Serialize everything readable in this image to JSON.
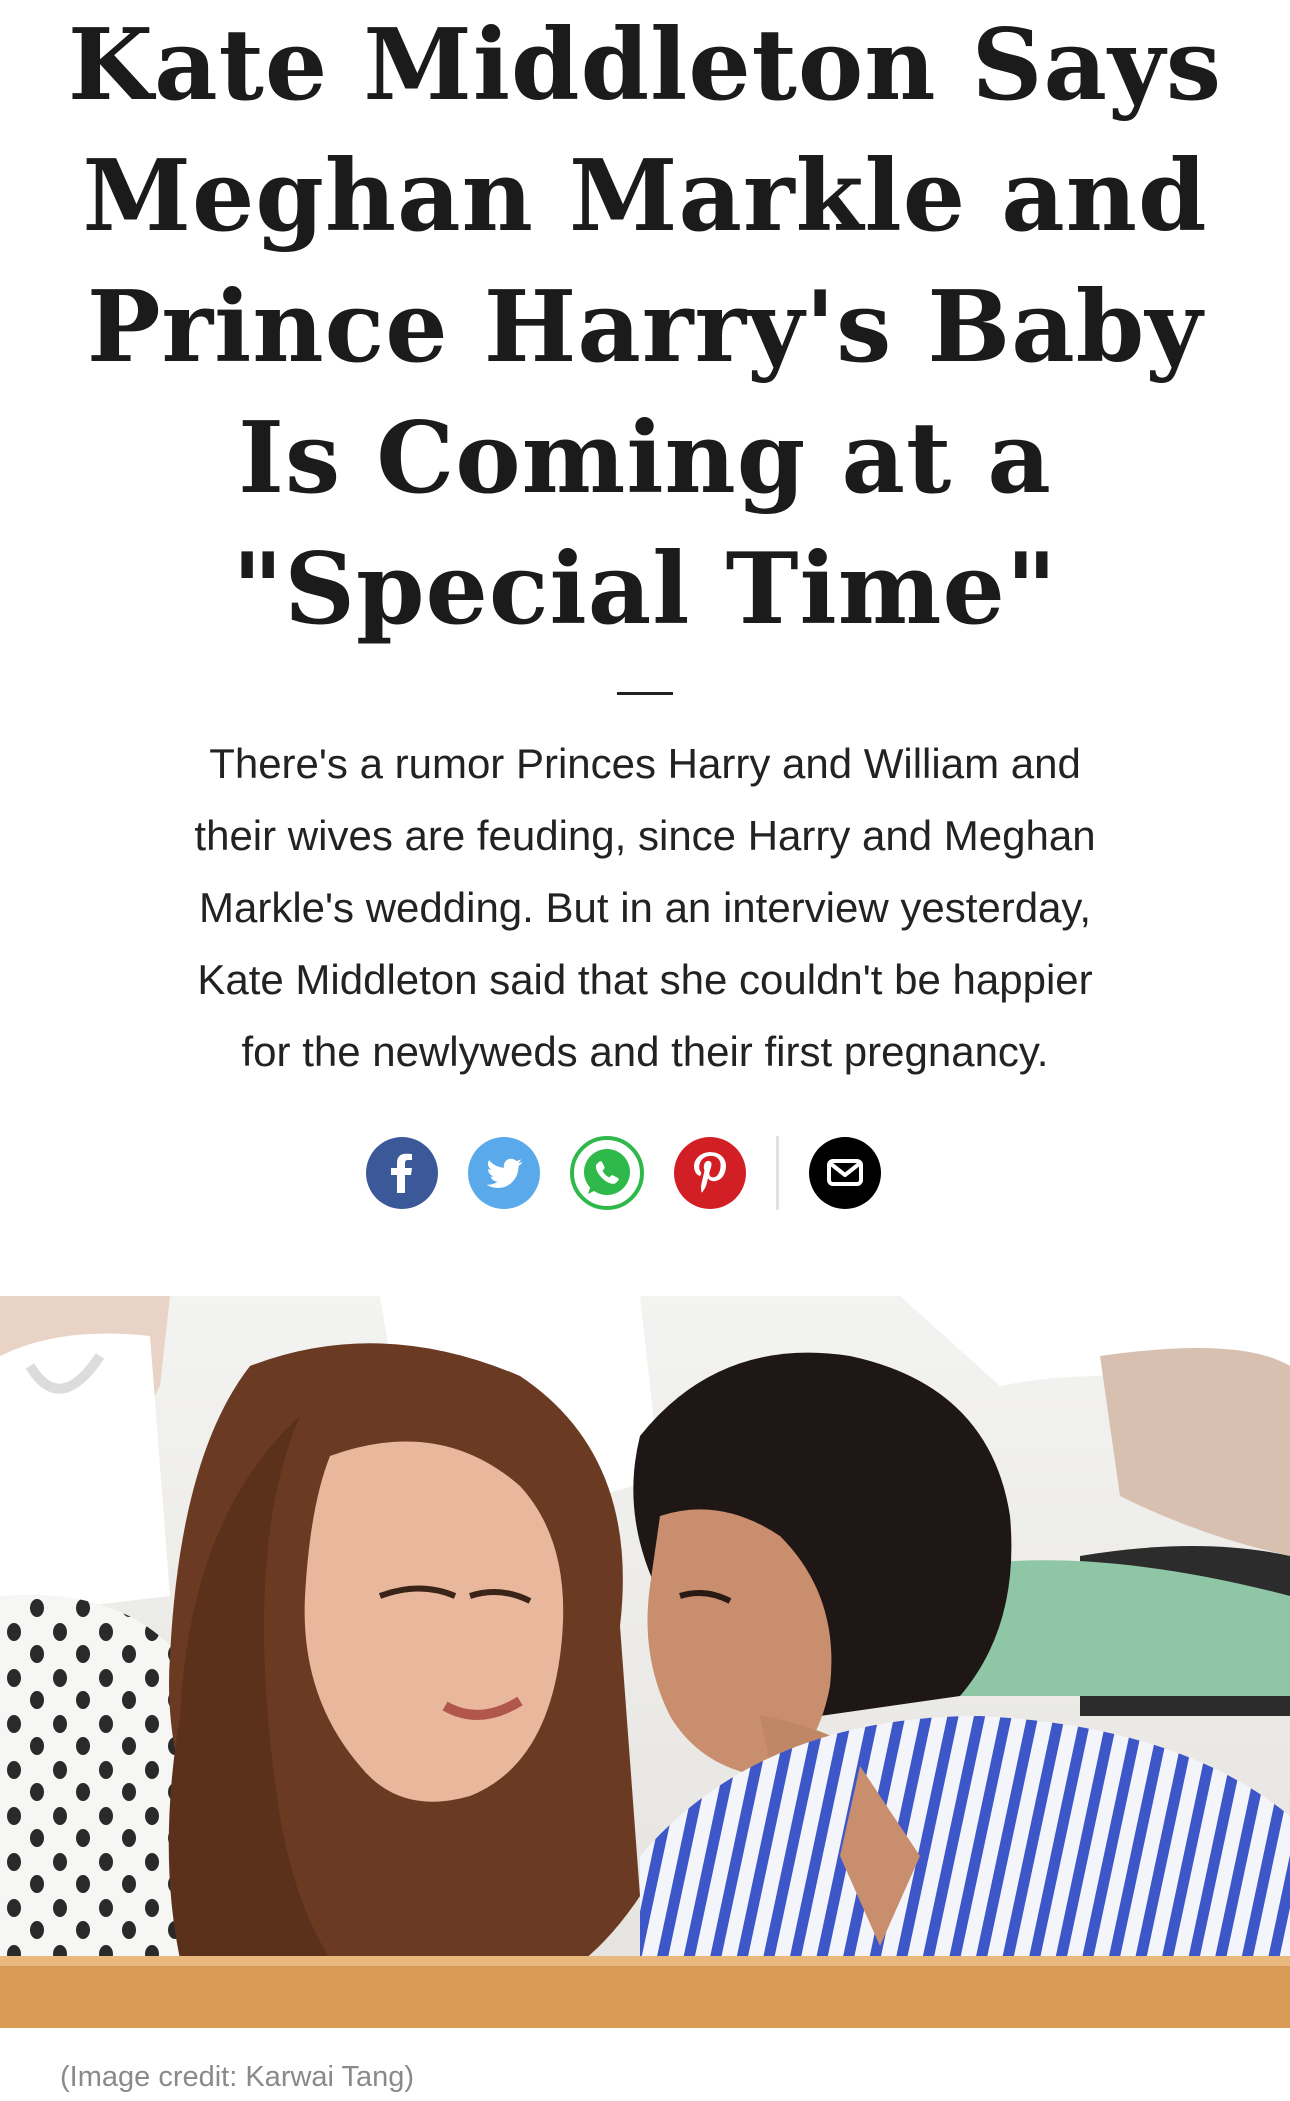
{
  "article": {
    "headline_lines": [
      "Kate Middleton Says",
      "Meghan Markle and",
      "Prince Harry's Baby",
      "Is Coming at a",
      "\"Special Time\""
    ],
    "standfirst_lines": [
      "There's a rumor Princes Harry and William and",
      "their wives are feuding, since Harry and Meghan",
      "Markle's wedding. But in an interview yesterday,",
      "Kate Middleton said that she couldn't be happier",
      "for the newlyweds and their first pregnancy."
    ],
    "image_caption": "(Image credit: Karwai Tang)"
  },
  "share": {
    "items": [
      {
        "name": "facebook",
        "icon": "facebook-icon",
        "color": "#3b5998"
      },
      {
        "name": "twitter",
        "icon": "twitter-icon",
        "color": "#5aa9ea"
      },
      {
        "name": "whatsapp",
        "icon": "whatsapp-icon",
        "color": "#2fb94a"
      },
      {
        "name": "pinterest",
        "icon": "pinterest-icon",
        "color": "#d21f26"
      },
      {
        "name": "email",
        "icon": "email-icon",
        "color": "#000000"
      }
    ]
  },
  "colors": {
    "headline": "#1b1b1b",
    "body_text": "#222222",
    "caption": "#8a8a8a"
  }
}
